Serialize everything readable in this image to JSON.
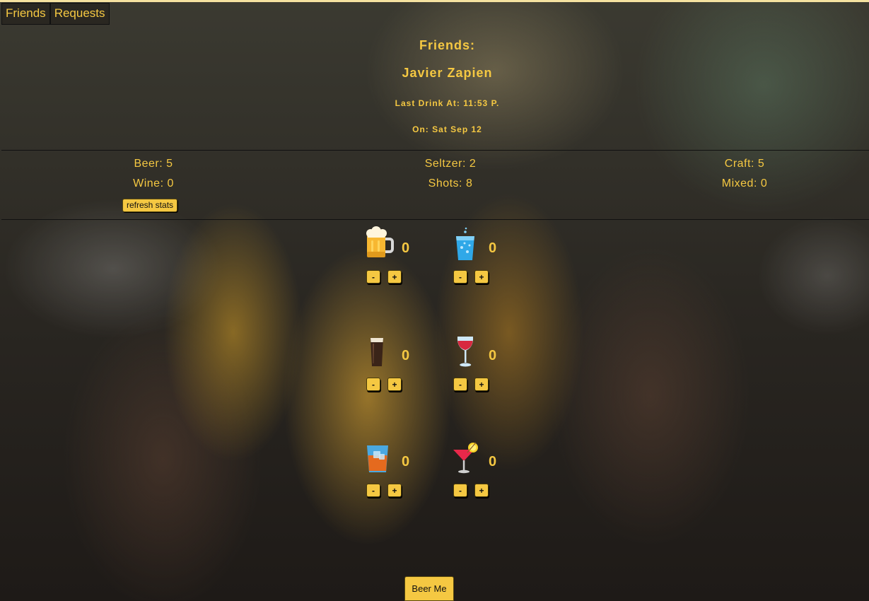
{
  "nav": {
    "tabs": [
      {
        "label": "Friends"
      },
      {
        "label": "Requests"
      }
    ]
  },
  "friend": {
    "heading": "Friends:",
    "name": "Javier Zapien",
    "last_drink": "Last Drink At: 11:53 P.",
    "on_date": "On: Sat Sep 12"
  },
  "stats": {
    "beer": "Beer: 5",
    "seltzer": "Seltzer: 2",
    "craft": "Craft: 5",
    "wine": "Wine: 0",
    "shots": "Shots: 8",
    "mixed": "Mixed: 0",
    "refresh_label": "refresh stats"
  },
  "drinks": [
    {
      "icon": "beer-mug-icon",
      "count": "0",
      "minus": "-",
      "plus": "+"
    },
    {
      "icon": "seltzer-glass-icon",
      "count": "0",
      "minus": "-",
      "plus": "+"
    },
    {
      "icon": "craft-pint-icon",
      "count": "0",
      "minus": "-",
      "plus": "+"
    },
    {
      "icon": "wine-glass-icon",
      "count": "0",
      "minus": "-",
      "plus": "+"
    },
    {
      "icon": "shot-tumbler-icon",
      "count": "0",
      "minus": "-",
      "plus": "+"
    },
    {
      "icon": "cocktail-glass-icon",
      "count": "0",
      "minus": "-",
      "plus": "+"
    }
  ],
  "action": {
    "beer_me_label": "Beer Me"
  },
  "colors": {
    "accent": "#f5c842",
    "text_dark": "#111111"
  }
}
